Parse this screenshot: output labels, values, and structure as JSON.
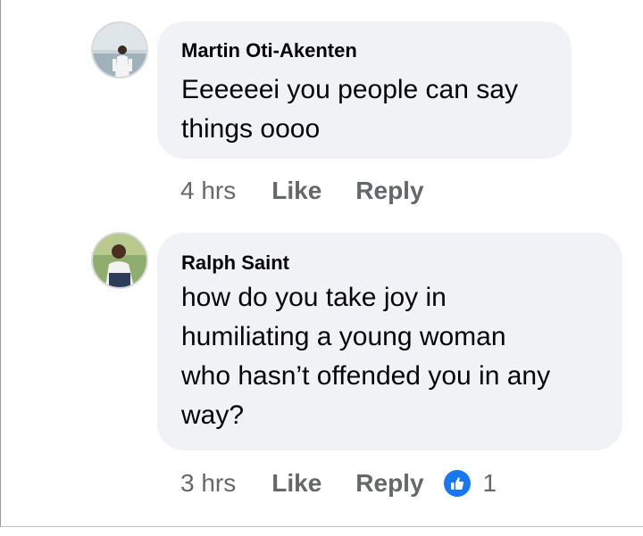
{
  "comments": [
    {
      "author": "Martin Oti-Akenten",
      "text_lines": [
        "Eeeeeei you people can say",
        "things oooo"
      ],
      "time": "4 hrs",
      "like_label": "Like",
      "reply_label": "Reply"
    },
    {
      "author": "Ralph Saint",
      "text_lines": [
        "how do you take joy in",
        "humiliating a young woman",
        "who hasn’t offended you in any",
        "way?"
      ],
      "time": "3 hrs",
      "like_label": "Like",
      "reply_label": "Reply",
      "reaction_count": "1",
      "reaction_icon": "like-thumb-icon"
    }
  ],
  "colors": {
    "bubble": "#f0f2f5",
    "meta_text": "#65676b",
    "like_blue": "#1877f2"
  }
}
